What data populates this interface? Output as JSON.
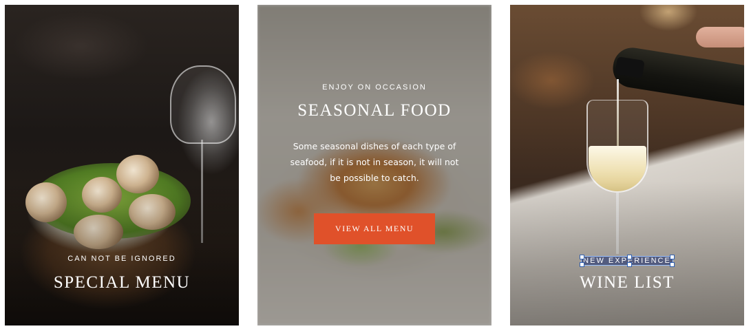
{
  "cards": [
    {
      "eyebrow": "CAN NOT BE IGNORED",
      "title": "SPECIAL MENU"
    },
    {
      "eyebrow": "ENJOY ON OCCASION",
      "title": "SEASONAL FOOD",
      "description": "Some seasonal dishes of each type of seafood, if it is not in season, it will not be possible to catch.",
      "button_label": "VIEW ALL MENU"
    },
    {
      "eyebrow": "NEW EXPERIENCE",
      "title": "WINE LIST"
    }
  ],
  "colors": {
    "accent_button": "#e0512a",
    "text": "#ffffff",
    "selection_outline": "#9ec3ff"
  },
  "icons": {
    "selection": "text-selection-handles"
  }
}
